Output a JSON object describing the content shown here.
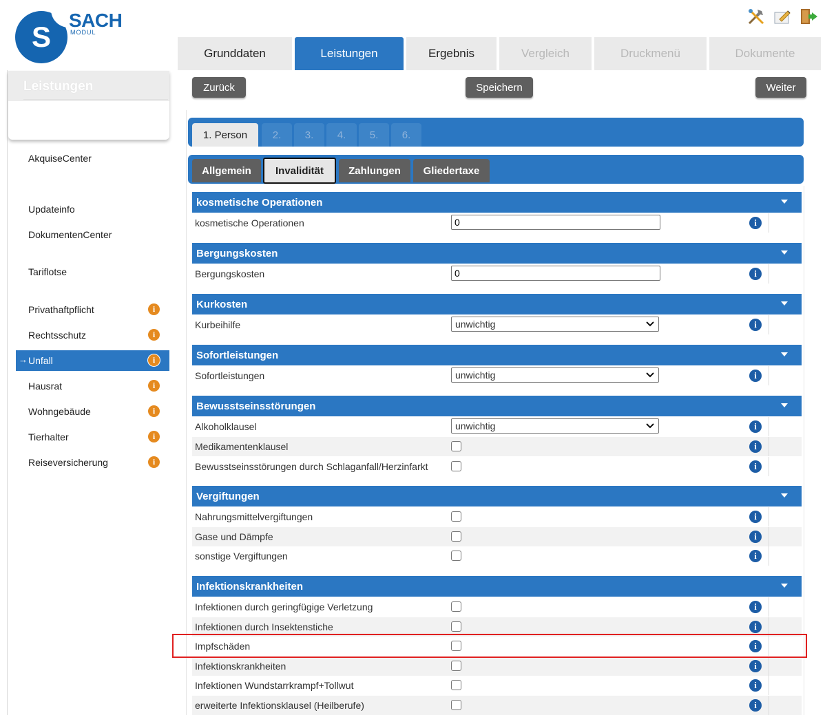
{
  "logo": {
    "letter": "S",
    "title": "SACH",
    "subtitle": "MODUL"
  },
  "top_icons": [
    "tools-icon",
    "edit-note-icon",
    "exit-door-icon"
  ],
  "main_tabs": [
    {
      "label": "Grunddaten",
      "state": "normal"
    },
    {
      "label": "Leistungen",
      "state": "active"
    },
    {
      "label": "Ergebnis",
      "state": "normal"
    },
    {
      "label": "Vergleich",
      "state": "disabled"
    },
    {
      "label": "Druckmenü",
      "state": "disabled"
    },
    {
      "label": "Dokumente",
      "state": "disabled"
    }
  ],
  "sidebar": {
    "title": "Leistungen",
    "items": [
      {
        "label": "AkquiseCenter"
      },
      {
        "label": "Updateinfo"
      },
      {
        "label": "DokumentenCenter"
      },
      {
        "label": "Tariflotse"
      },
      {
        "label": "Privathaftpflicht"
      },
      {
        "label": "Rechtsschutz"
      },
      {
        "label": "Unfall",
        "active": true,
        "arrow": "→"
      },
      {
        "label": "Hausrat"
      },
      {
        "label": "Wohngebäude"
      },
      {
        "label": "Tierhalter"
      },
      {
        "label": "Reiseversicherung"
      }
    ],
    "info_glyph": "i"
  },
  "actions": {
    "back": "Zurück",
    "save": "Speichern",
    "next": "Weiter"
  },
  "person_tabs": [
    "1. Person",
    "2.",
    "3.",
    "4.",
    "5.",
    "6."
  ],
  "sub_tabs": [
    "Allgemein",
    "Invalidität",
    "Zahlungen",
    "Gliedertaxe"
  ],
  "sections": {
    "kosmetik": {
      "title": "kosmetische Operationen",
      "rows": [
        {
          "label": "kosmetische Operationen",
          "value": "0"
        }
      ]
    },
    "bergung": {
      "title": "Bergungskosten",
      "rows": [
        {
          "label": "Bergungskosten",
          "value": "0"
        }
      ]
    },
    "kur": {
      "title": "Kurkosten",
      "rows": [
        {
          "label": "Kurbeihilfe",
          "value": "unwichtig"
        }
      ]
    },
    "sofort": {
      "title": "Sofortleistungen",
      "rows": [
        {
          "label": "Sofortleistungen",
          "value": "unwichtig"
        }
      ]
    },
    "bewusst": {
      "title": "Bewusstseinsstörungen",
      "rows": [
        {
          "label": "Alkoholklausel",
          "value": "unwichtig"
        },
        {
          "label": "Medikamentenklausel"
        },
        {
          "label": "Bewusstseinsstörungen durch Schlaganfall/Herzinfarkt"
        }
      ]
    },
    "vergift": {
      "title": "Vergiftungen",
      "rows": [
        {
          "label": "Nahrungsmittelvergiftungen"
        },
        {
          "label": "Gase und Dämpfe"
        },
        {
          "label": "sonstige Vergiftungen"
        }
      ]
    },
    "infekt": {
      "title": "Infektionskrankheiten",
      "rows": [
        {
          "label": "Infektionen durch geringfügige Verletzung"
        },
        {
          "label": "Infektionen durch Insektenstiche"
        },
        {
          "label": "Impfschäden"
        },
        {
          "label": "Infektionskrankheiten"
        },
        {
          "label": "Infektionen Wundstarrkrampf+Tollwut"
        },
        {
          "label": "erweiterte Infektionsklausel (Heilberufe)"
        }
      ]
    }
  },
  "info_glyph": "i",
  "colors": {
    "primary": "#2b77c2",
    "button": "#5f5f5f",
    "info_orange": "#e58a1f",
    "info_blue": "#1d5da6",
    "highlight": "#e02020"
  }
}
